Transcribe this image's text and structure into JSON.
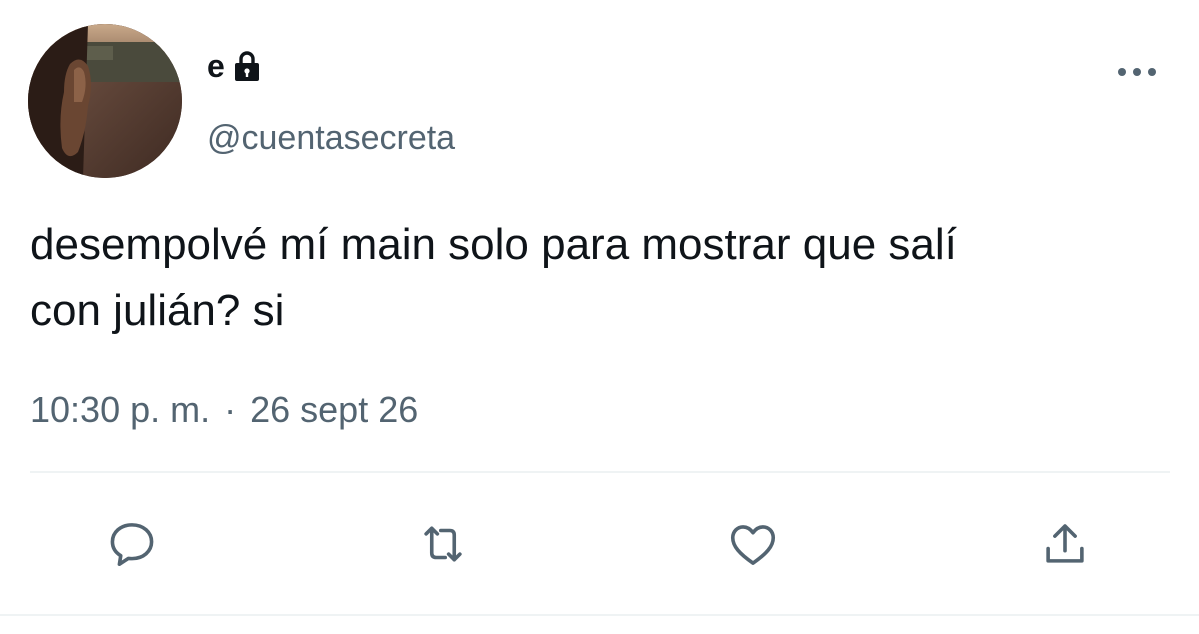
{
  "tweet": {
    "display_name": "e",
    "handle": "@cuentasecreta",
    "text": "desempolvé mí main solo para mostrar que salí\ncon julián? si",
    "time": "10:30 p. m.",
    "separator": "·",
    "date": "26 sept 26"
  },
  "icons": {
    "lock": "lock-icon",
    "more": "more-horizontal-icon",
    "reply": "reply-bubble-icon",
    "retweet": "retweet-icon",
    "like": "heart-icon",
    "share": "share-icon"
  },
  "colors": {
    "text_primary": "#0f1419",
    "text_secondary": "#536471",
    "divider": "#eff3f4"
  }
}
